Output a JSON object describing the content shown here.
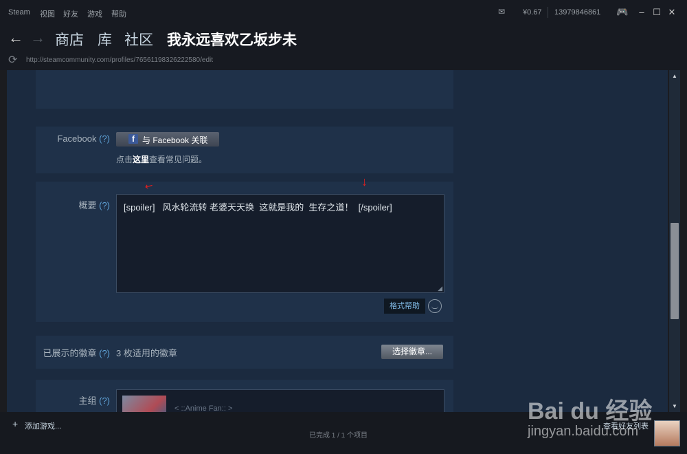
{
  "titlebar": {
    "app_name": "Steam",
    "menu": [
      "视图",
      "好友",
      "游戏",
      "帮助"
    ],
    "balance": "¥0.67",
    "account": "13979846861"
  },
  "nav": {
    "tabs": [
      "商店",
      "库",
      "社区"
    ],
    "user": "我永远喜欢乙坂步未",
    "url": "http://steamcommunity.com/profiles/76561198326222580/edit"
  },
  "facebook": {
    "label": "Facebook",
    "help": "(?)",
    "button_label": "与 Facebook 关联",
    "faq_prefix": "点击",
    "faq_link": "这里",
    "faq_suffix": "查看常见问题。"
  },
  "summary": {
    "label": "概要",
    "help": "(?)",
    "text": "[spoiler]   风水轮流转 老婆天天换  这就是我的  生存之道！  [/spoiler]",
    "format_help": "格式帮助"
  },
  "badges": {
    "label": "已展示的徽章",
    "help": "(?)",
    "count_text": "3 枚适用的徽章",
    "select_button": "选择徽章..."
  },
  "group": {
    "label": "主组",
    "help": "(?)",
    "name": "< ::Anime Fan:: >"
  },
  "footer": {
    "add_game": "添加游戏...",
    "progress": "已完成 1 / 1 个项目",
    "friends": "查看好友列表"
  },
  "watermark": {
    "brand": "Bai du 经验",
    "url": "jingyan.baidu.com"
  },
  "colors": {
    "accent": "#5fa3d8",
    "content_bg": "#1b2a3f",
    "annotation_arrow": "#e02020"
  }
}
